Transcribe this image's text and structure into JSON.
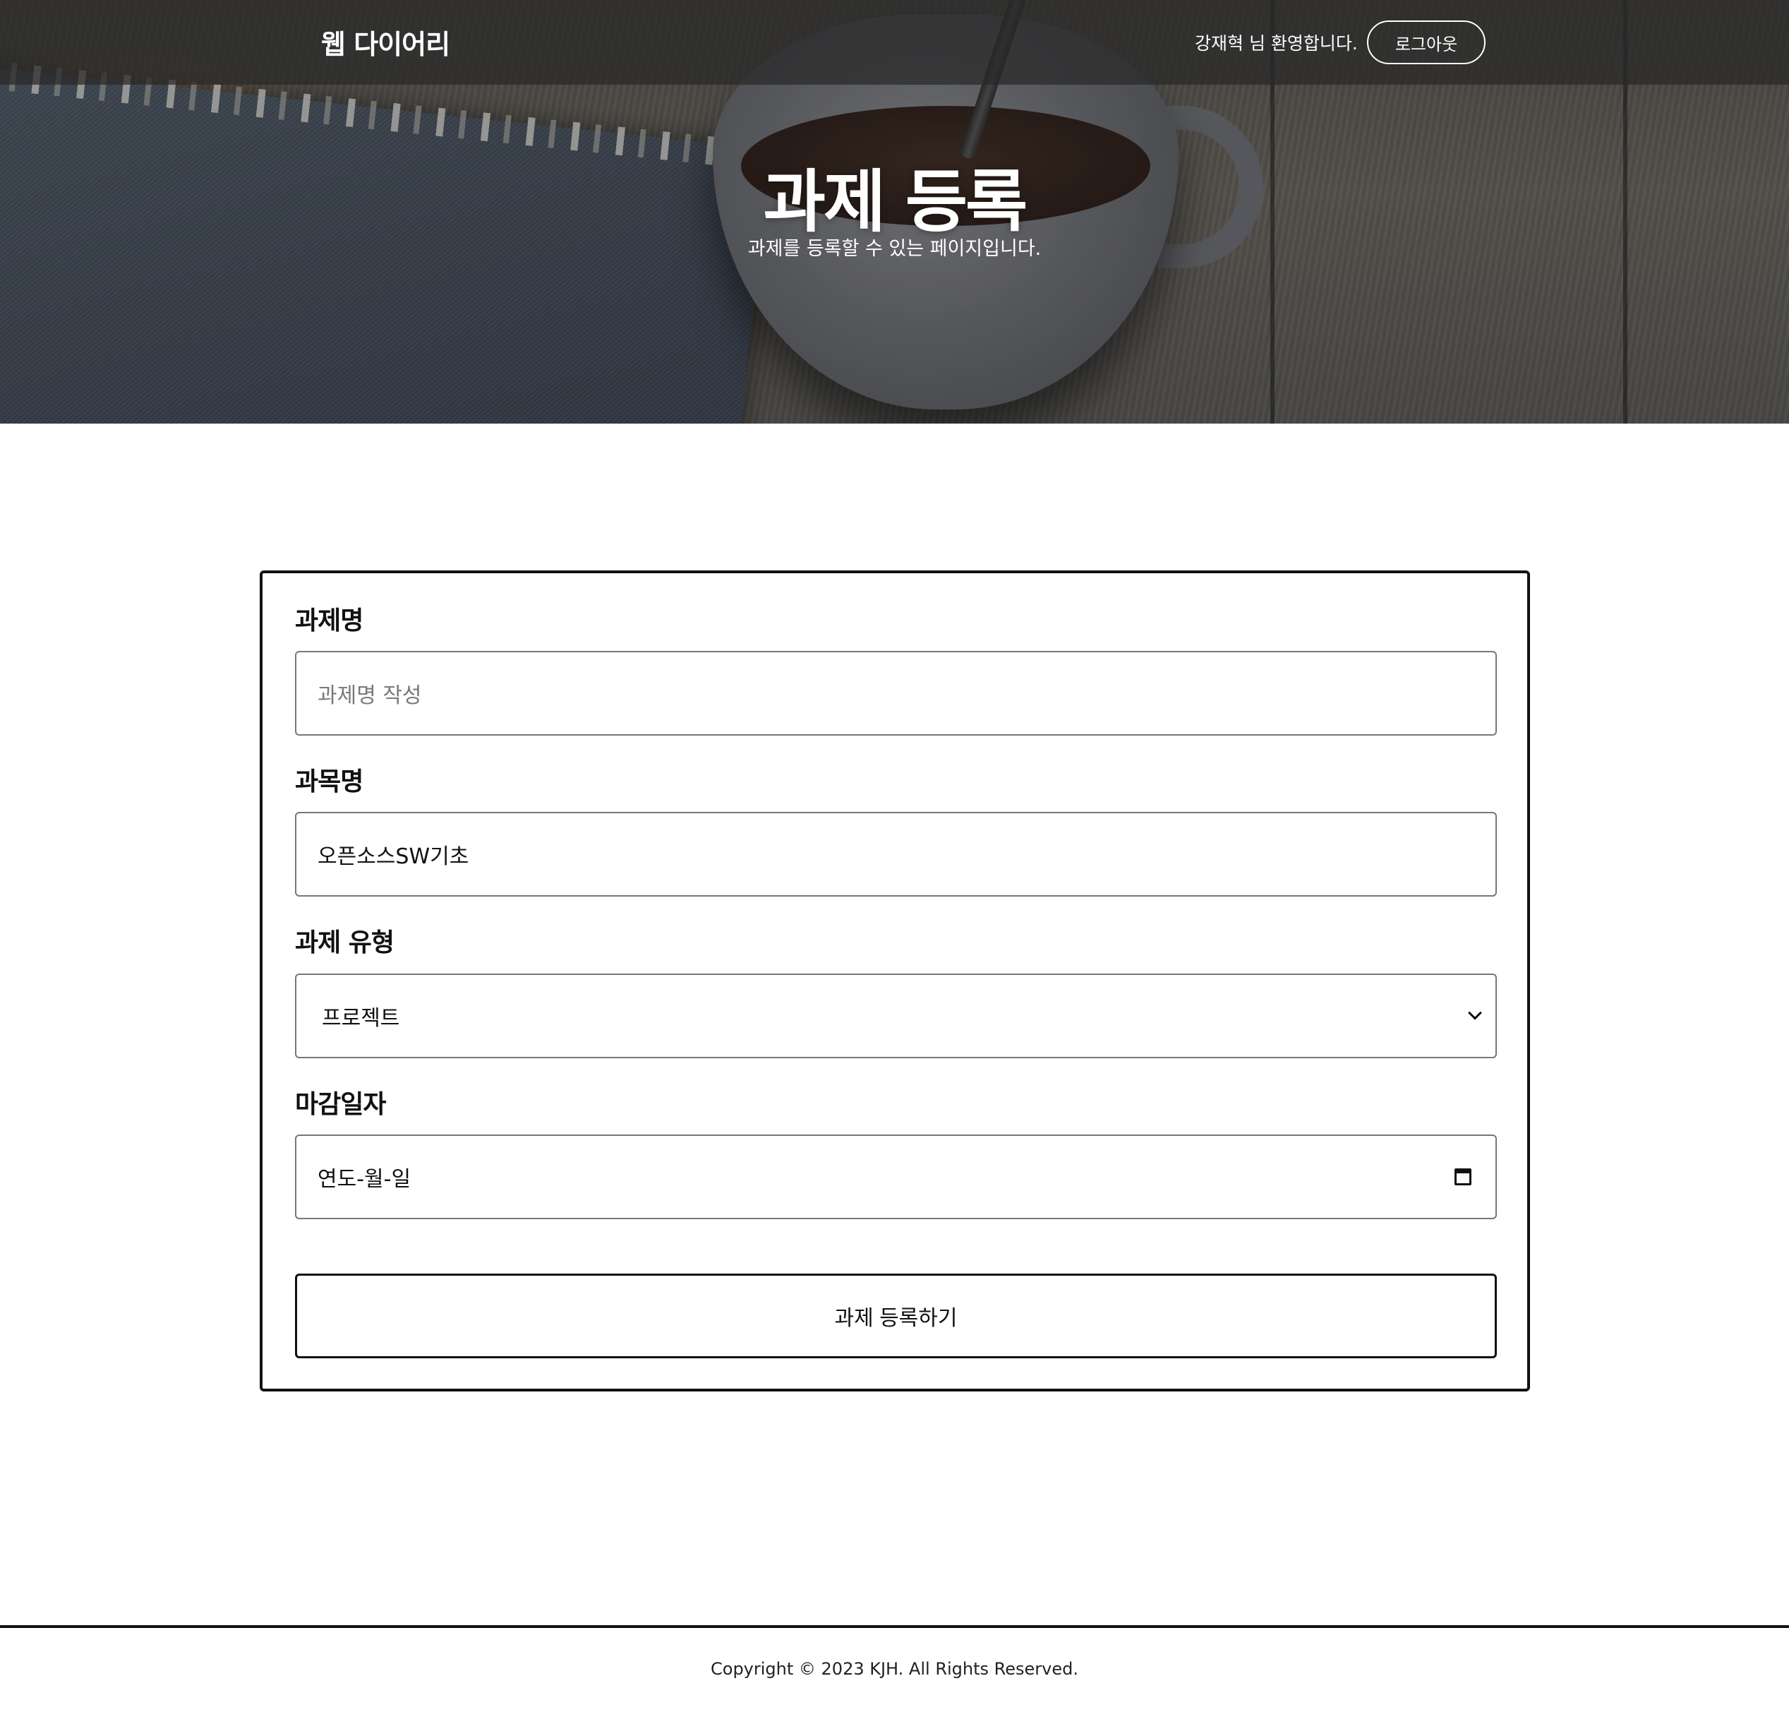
{
  "navbar": {
    "brand": "웹 다이어리",
    "welcome": "강재혁 님 환영합니다.",
    "logout_label": "로그아웃"
  },
  "hero": {
    "title": "과제 등록",
    "subtitle": "과제를 등록할 수 있는 페이지입니다."
  },
  "form": {
    "title_field": {
      "label": "과제명",
      "value": "",
      "placeholder": "과제명 작성"
    },
    "subject_field": {
      "label": "과목명",
      "value": "오픈소스SW기초"
    },
    "type_field": {
      "label": "과제 유형",
      "selected": "프로젝트"
    },
    "due_field": {
      "label": "마감일자",
      "value": "연도-월-일"
    },
    "submit_label": "과제 등록하기"
  },
  "footer": {
    "copyright": "Copyright © 2023 KJH. All Rights Reserved."
  },
  "icons": {
    "select_arrow": "chevron-down-icon",
    "date_picker": "calendar-icon"
  },
  "colors": {
    "navbar_bg": "#282828",
    "text_primary": "#111111",
    "border": "#777777",
    "placeholder": "#7a7a7a"
  }
}
